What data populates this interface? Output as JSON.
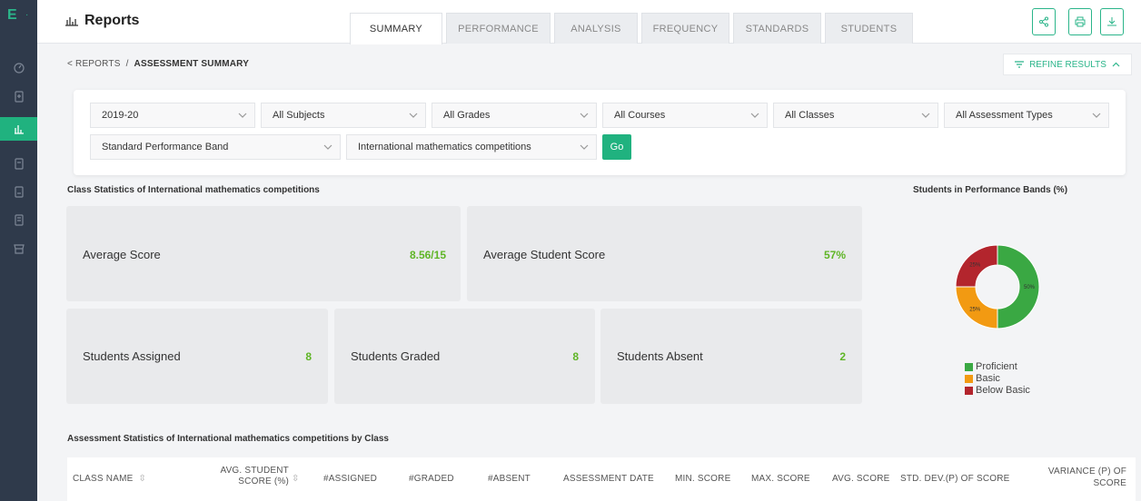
{
  "app": {
    "logo": "E",
    "logo_dot": "·"
  },
  "sidebar": {
    "items": [
      {
        "icon": "dashboard-icon",
        "active": false
      },
      {
        "icon": "clipboard-icon",
        "active": false
      },
      {
        "icon": "reports-chart-icon",
        "active": true
      },
      {
        "icon": "assessment-icon",
        "active": false
      },
      {
        "icon": "assignment-icon",
        "active": false
      },
      {
        "icon": "document-icon",
        "active": false
      },
      {
        "icon": "store-icon",
        "active": false
      }
    ]
  },
  "header": {
    "title": "Reports",
    "tabs": [
      "SUMMARY",
      "PERFORMANCE",
      "ANALYSIS",
      "FREQUENCY",
      "STANDARDS",
      "STUDENTS"
    ],
    "active_tab": "SUMMARY",
    "actions": [
      "share-icon",
      "print-icon",
      "download-icon"
    ]
  },
  "breadcrumb": {
    "root": "< REPORTS",
    "sep": "/",
    "current": "ASSESSMENT SUMMARY"
  },
  "refine": {
    "label": "REFINE RESULTS",
    "icon": "filter-icon"
  },
  "filters": {
    "year": "2019-20",
    "subject": "All Subjects",
    "grade": "All Grades",
    "course": "All Courses",
    "class": "All Classes",
    "assessment_type": "All Assessment Types",
    "band": "Standard Performance Band",
    "assessment": "International mathematics competitions",
    "go_label": "Go"
  },
  "class_stats": {
    "title": "Class Statistics of International mathematics competitions",
    "average_score": {
      "label": "Average Score",
      "value": "8.56/15"
    },
    "average_student_score": {
      "label": "Average Student Score",
      "value": "57%"
    },
    "students_assigned": {
      "label": "Students Assigned",
      "value": "8"
    },
    "students_graded": {
      "label": "Students Graded",
      "value": "8"
    },
    "students_absent": {
      "label": "Students  Absent",
      "value": "2"
    }
  },
  "chart_data": {
    "type": "pie",
    "title": "Students in Performance Bands (%)",
    "categories": [
      "Proficient",
      "Basic",
      "Below Basic"
    ],
    "values": [
      50,
      25,
      25
    ],
    "labels": [
      "50%",
      "25%",
      "25%"
    ],
    "colors": [
      "#3aa843",
      "#f29a12",
      "#b3252d"
    ],
    "donut": true,
    "legend_position": "bottom"
  },
  "assessment_stats": {
    "title": "Assessment Statistics of International mathematics competitions by Class",
    "columns": [
      "CLASS NAME",
      "AVG. STUDENT SCORE (%)",
      "#ASSIGNED",
      "#GRADED",
      "#ABSENT",
      "ASSESSMENT DATE",
      "MIN. SCORE",
      "MAX. SCORE",
      "AVG. SCORE",
      "STD. DEV.(P) OF SCORE",
      "VARIANCE (P) OF SCORE"
    ]
  }
}
